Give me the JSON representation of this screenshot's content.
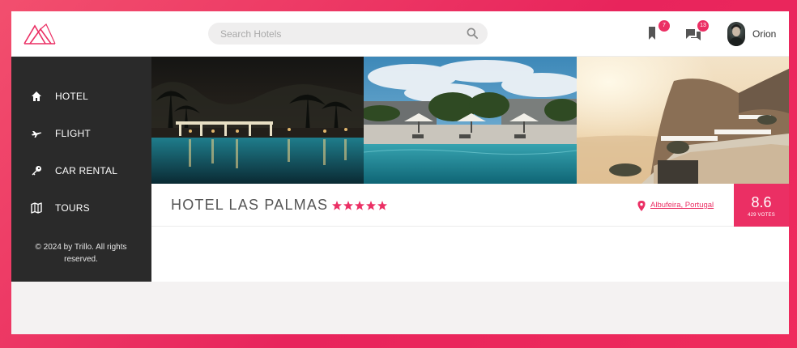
{
  "header": {
    "search": {
      "placeholder": "Search Hotels",
      "value": ""
    },
    "bookmarks": {
      "count": "7",
      "icon": "bookmark-icon"
    },
    "messages": {
      "count": "13",
      "icon": "chat-icon"
    },
    "user": {
      "name": "Orion"
    }
  },
  "sidebar": {
    "items": [
      {
        "label": "HOTEL",
        "icon": "home-icon"
      },
      {
        "label": "FLIGHT",
        "icon": "airplane-icon"
      },
      {
        "label": "CAR RENTAL",
        "icon": "key-icon"
      },
      {
        "label": "TOURS",
        "icon": "map-icon"
      }
    ],
    "legal": "© 2024 by Trillo. All rights reserved."
  },
  "hotel": {
    "name": "HOTEL LAS PALMAS",
    "stars": 5,
    "location": "Albufeira, Portugal",
    "rating": {
      "average": "8.6",
      "votes": "429 VOTES"
    }
  },
  "colors": {
    "accent": "#eb2f64",
    "sidebar_bg": "#2a2a2a",
    "page_bg": "#f4f2f2",
    "frame_gradient": [
      "#f24f6e",
      "#e8245c"
    ]
  }
}
